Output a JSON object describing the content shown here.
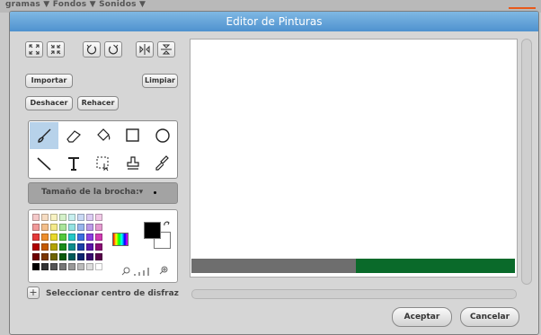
{
  "background_tabs": {
    "text": "gramas ▼ Fondos ▼ Sonidos ▼"
  },
  "dialog": {
    "title": "Editor de Pinturas"
  },
  "toolbar_icons": [
    "grow-icon",
    "shrink-icon",
    "rotate-left-icon",
    "rotate-right-icon",
    "flip-horizontal-icon",
    "flip-vertical-icon"
  ],
  "buttons": {
    "import": "Importar",
    "clear": "Limpiar",
    "undo": "Deshacer",
    "redo": "Rehacer"
  },
  "tools": [
    "brush-icon",
    "eraser-icon",
    "fill-icon",
    "rectangle-icon",
    "ellipse-icon",
    "line-icon",
    "text-icon",
    "select-icon",
    "stamp-icon",
    "eyedropper-icon"
  ],
  "brush_size": {
    "label": "Tamaño de la brocha:▾"
  },
  "palette": {
    "colors": [
      [
        "#f4c9c9",
        "#f6dcc2",
        "#f7f2c2",
        "#d4f1c9",
        "#c7efef",
        "#c9d8f4",
        "#dccbf3",
        "#f1c9e7"
      ],
      [
        "#f19a9a",
        "#f4bf8a",
        "#f4ea8a",
        "#a9e59a",
        "#93e2e2",
        "#98b4ec",
        "#bd9ae8",
        "#e59ad1"
      ],
      [
        "#e53a3a",
        "#ee8f2c",
        "#e9d92a",
        "#53c83c",
        "#22c7c7",
        "#3a6ee0",
        "#8a3ce0",
        "#d13ab2"
      ],
      [
        "#b00000",
        "#c45a00",
        "#b3a400",
        "#1a8c1a",
        "#0c8c8c",
        "#1a3ea8",
        "#5a14a8",
        "#8c0c76"
      ],
      [
        "#6e0000",
        "#7a3600",
        "#6e6400",
        "#0c5a0c",
        "#005a5a",
        "#0c2470",
        "#38096e",
        "#5a004c"
      ],
      [
        "#000000",
        "#333333",
        "#555555",
        "#777777",
        "#999999",
        "#bbbbbb",
        "#dddddd",
        "#ffffff"
      ]
    ],
    "primary_color": "#000000",
    "secondary_color": "#ffffff"
  },
  "footer": {
    "set_center_label": "Seleccionar centro de disfraz",
    "accept": "Aceptar",
    "cancel": "Cancelar"
  }
}
